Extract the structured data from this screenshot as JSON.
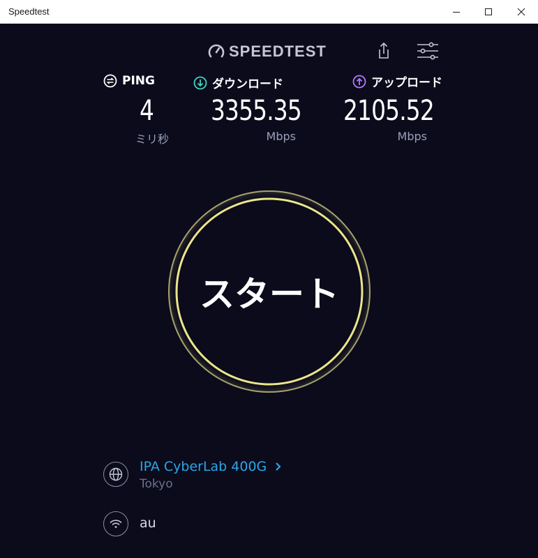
{
  "window": {
    "title": "Speedtest"
  },
  "header": {
    "logo_text": "SPEEDTEST",
    "share_icon": "share-icon",
    "settings_icon": "settings-sliders-icon"
  },
  "ping": {
    "label": "PING",
    "value": "4",
    "unit": "ミリ秒",
    "color": "#ffffff"
  },
  "download": {
    "label": "ダウンロード",
    "value": "3355.35",
    "unit": "Mbps",
    "color": "#3ed7c2"
  },
  "upload": {
    "label": "アップロード",
    "value": "2105.52",
    "unit": "Mbps",
    "color": "#b77bff"
  },
  "start": {
    "label": "スタート",
    "ring_color": "#e8e27a"
  },
  "server": {
    "name": "IPA CyberLab 400G",
    "location": "Tokyo",
    "link_color": "#2aa6e6"
  },
  "network": {
    "name": "au"
  }
}
